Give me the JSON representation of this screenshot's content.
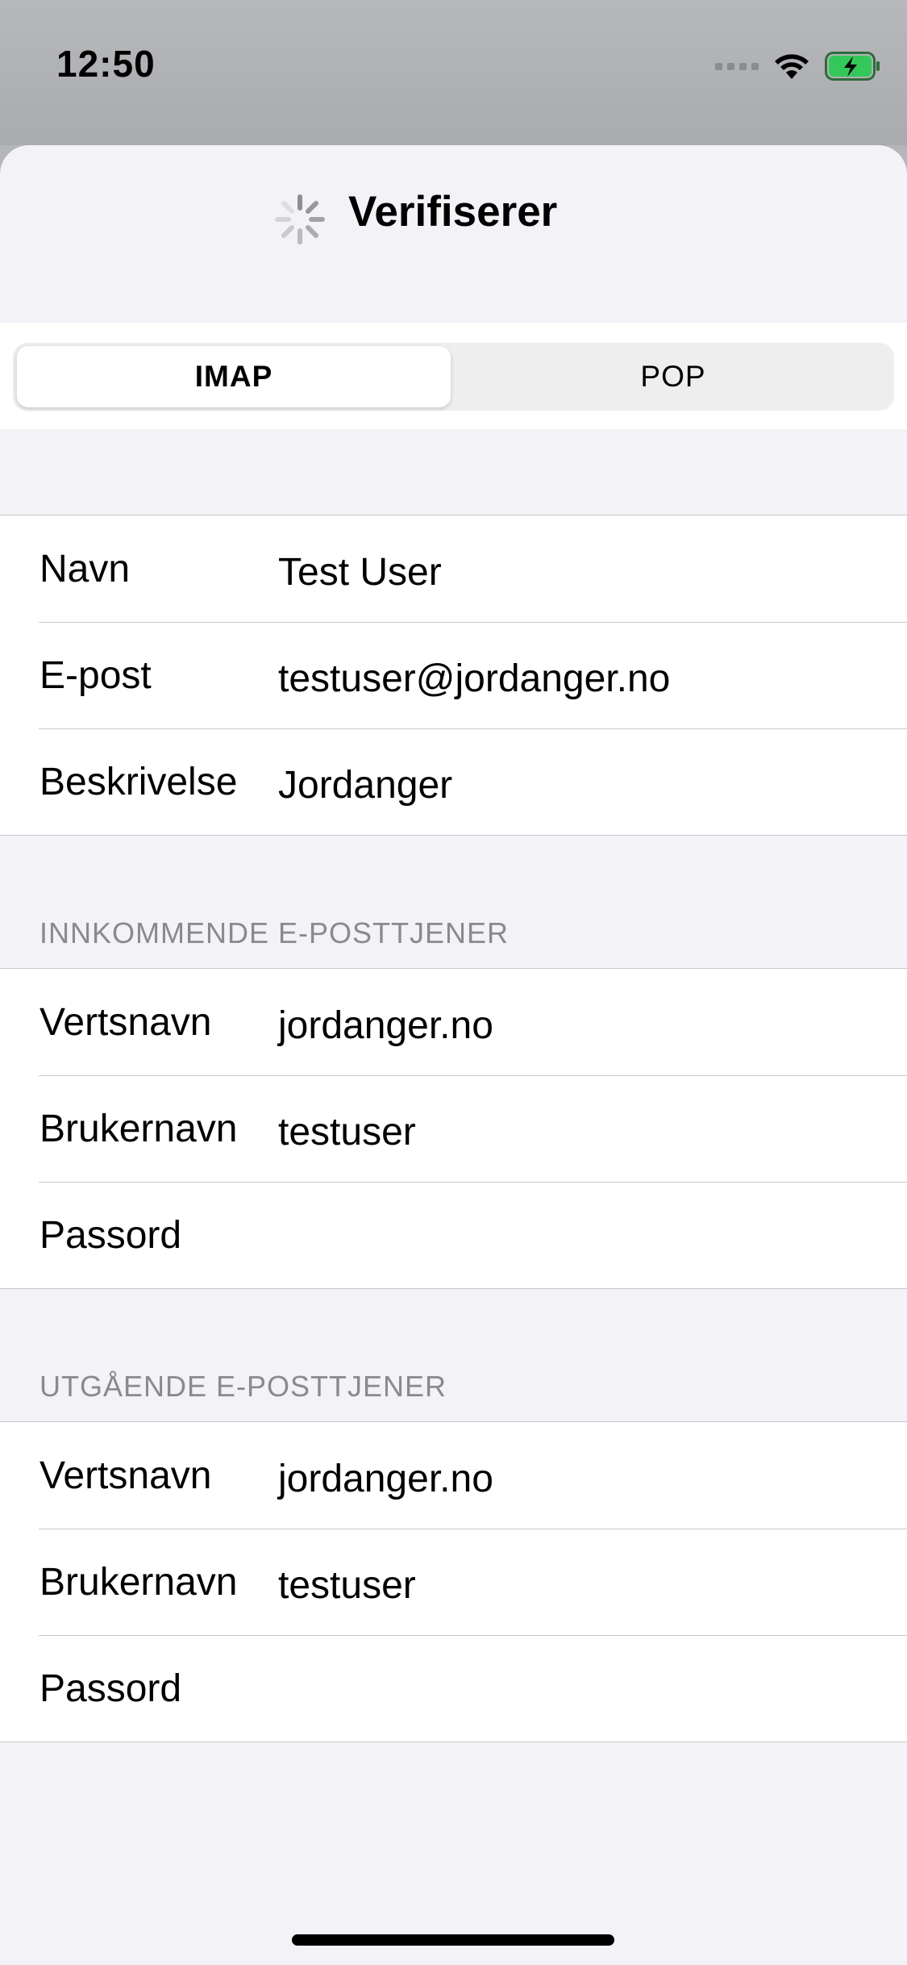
{
  "status_bar": {
    "time": "12:50",
    "icons": [
      "cellular-signal-icon",
      "wifi-icon",
      "battery-charging-icon"
    ],
    "battery_color": "#34c759"
  },
  "nav": {
    "title": "Verifiserer",
    "spinner": "activity-spinner-icon"
  },
  "segments": {
    "options": [
      "IMAP",
      "POP"
    ],
    "selected": "IMAP"
  },
  "account": {
    "rows": [
      {
        "label": "Navn",
        "value": "Test User"
      },
      {
        "label": "E-post",
        "value": "testuser@jordanger.no"
      },
      {
        "label": "Beskrivelse",
        "value": "Jordanger"
      }
    ]
  },
  "incoming": {
    "header": "INNKOMMENDE E-POSTTJENER",
    "rows": [
      {
        "label": "Vertsnavn",
        "value": "jordanger.no"
      },
      {
        "label": "Brukernavn",
        "value": "testuser"
      },
      {
        "label": "Passord",
        "value": ""
      }
    ]
  },
  "outgoing": {
    "header": "UTGÅENDE E-POSTTJENER",
    "rows": [
      {
        "label": "Vertsnavn",
        "value": "jordanger.no"
      },
      {
        "label": "Brukernavn",
        "value": "testuser"
      },
      {
        "label": "Passord",
        "value": ""
      }
    ]
  },
  "colors": {
    "background": "#f2f2f7",
    "separator": "#c8c7cc",
    "header_text": "#8a8a8e"
  }
}
